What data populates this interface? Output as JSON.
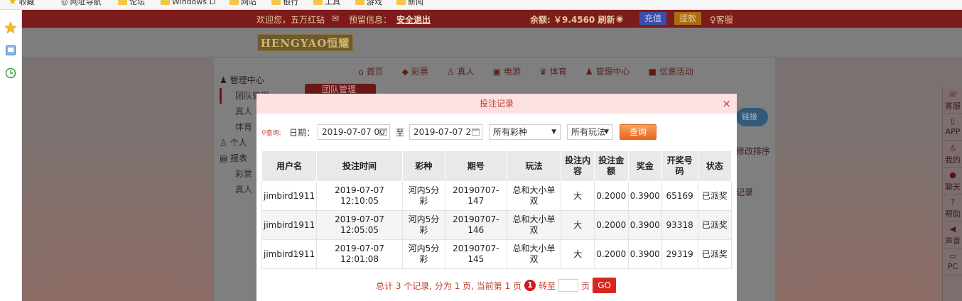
{
  "bookmarks": {
    "items": [
      "收藏",
      "网址导航",
      "论坛",
      "Windows Li",
      "网站",
      "银行",
      "工具",
      "游戏",
      "新闻"
    ]
  },
  "topbar": {
    "welcome": "欢迎您，五万红钻",
    "reserve_info": "预留信息：",
    "logout": "安全退出",
    "balance": "余额: ￥9.4560 刷新",
    "recharge": "充值",
    "withdraw": "提款",
    "service": "客服"
  },
  "logo_text": "HENGYAO恒耀",
  "nav": {
    "items": [
      "首页",
      "彩票",
      "真人",
      "电游",
      "体育",
      "管理中心",
      "优惠活动"
    ]
  },
  "leftmenu": {
    "items": [
      "管理中心",
      "团队管理",
      "真人",
      "体育",
      "个人",
      "报表",
      "彩票",
      "真人"
    ]
  },
  "background_tab": "团队管理",
  "right_peek": {
    "pill": "链接",
    "sort": "修改排序",
    "record": "记录"
  },
  "right_dock": {
    "items": [
      "客服",
      "APP",
      "我的",
      "聊天",
      "帮助",
      "声音",
      "PC"
    ]
  },
  "modal": {
    "title": "投注记录",
    "close": "×",
    "filter": {
      "query_label": "查询:",
      "date_label": "日期：",
      "date_from": "2019-07-07 00",
      "to_label": "至",
      "date_to": "2019-07-07 2",
      "lottery_select": "所有彩种",
      "play_select": "所有玩法",
      "query_button": "查询"
    },
    "table": {
      "headers": [
        "用户名",
        "投注时间",
        "彩种",
        "期号",
        "玩法",
        "投注内容",
        "投注金额",
        "奖金",
        "开奖号码",
        "状态"
      ],
      "rows": [
        [
          "jimbird1911",
          "2019-07-07 12:10:05",
          "河内5分彩",
          "20190707-147",
          "总和大小单双",
          "大",
          "0.2000",
          "0.3900",
          "65169",
          "已派奖"
        ],
        [
          "jimbird1911",
          "2019-07-07 12:05:05",
          "河内5分彩",
          "20190707-146",
          "总和大小单双",
          "大",
          "0.2000",
          "0.3900",
          "93318",
          "已派奖"
        ],
        [
          "jimbird1911",
          "2019-07-07 12:01:08",
          "河内5分彩",
          "20190707-145",
          "总和大小单双",
          "大",
          "0.2000",
          "0.3900",
          "29319",
          "已派奖"
        ]
      ]
    },
    "pager": {
      "summary": "总计 3 个记录, 分为 1 页, 当前第 1 页",
      "current_page": "1",
      "goto_label": "转至",
      "page_unit": "页",
      "go_button": "GO"
    }
  },
  "colors": {
    "topbar": "#7e1b1d",
    "modal_header": "#fde0e0",
    "accent_red": "#c0392b",
    "query_button": "#e8671e"
  }
}
